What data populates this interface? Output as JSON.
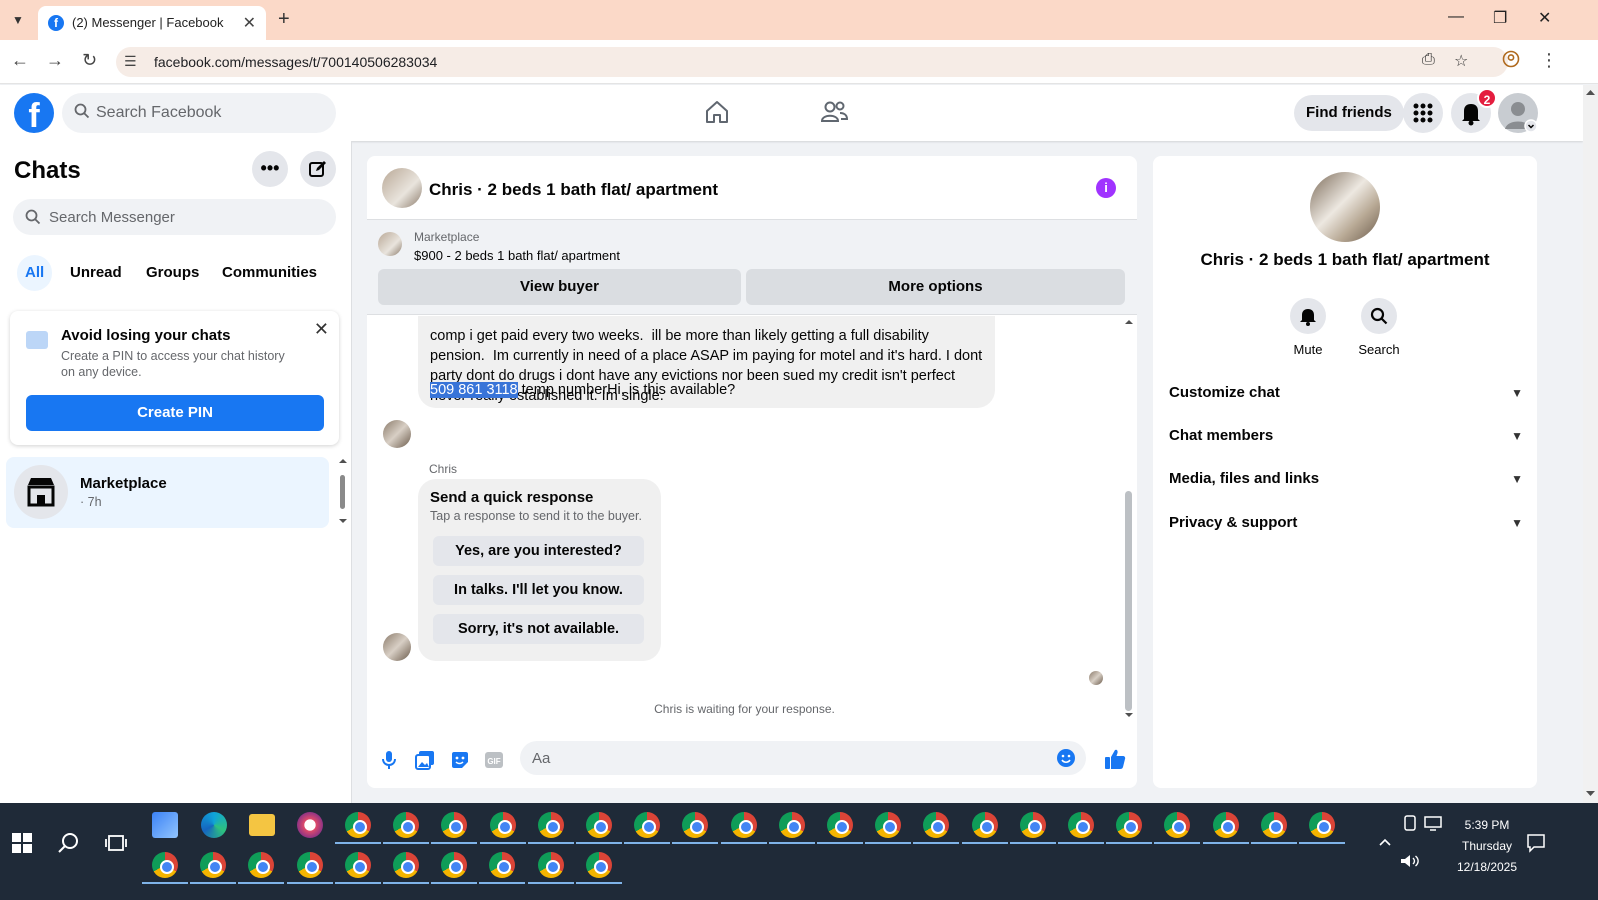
{
  "browser": {
    "tab_title": "(2) Messenger | Facebook",
    "url": "facebook.com/messages/t/700140506283034"
  },
  "header": {
    "search_placeholder": "Search Facebook",
    "find_friends": "Find friends",
    "notification_count": "2"
  },
  "sidebar": {
    "title": "Chats",
    "search_placeholder": "Search Messenger",
    "filters": [
      "All",
      "Unread",
      "Groups",
      "Communities"
    ],
    "pin_card": {
      "title": "Avoid losing your chats",
      "description": "Create a PIN to access your chat history on any device.",
      "button": "Create PIN"
    },
    "conversations": [
      {
        "name": "Marketplace",
        "time": "· 7h"
      }
    ]
  },
  "chat": {
    "title": "Chris · 2 beds 1 bath flat/ apartment",
    "marketplace": {
      "label": "Marketplace",
      "listing": "$900 - 2 beds 1 bath flat/ apartment",
      "view_buyer": "View buyer",
      "more_options": "More options"
    },
    "message_text": "comp i get paid every two weeks.  ill be more than likely getting a full disability pension.  Im currently in need of a place ASAP im paying for motel and it's hard. I dont party dont do drugs i dont have any evictions nor been sued my credit isn't perfect never really established it. Im single.",
    "phone_highlight": "509 861 3118",
    "message_tail": " temp numberHi, is this available?",
    "sender": "Chris",
    "quick_response": {
      "title": "Send a quick response",
      "subtitle": "Tap a response to send it to the buyer.",
      "options": [
        "Yes, are you interested?",
        "In talks. I'll let you know.",
        "Sorry, it's not available."
      ]
    },
    "waiting_text": "Chris is waiting for your response.",
    "composer_placeholder": "Aa"
  },
  "details": {
    "name": "Chris · 2 beds 1 bath flat/ apartment",
    "actions": [
      "Mute",
      "Search"
    ],
    "sections": [
      "Customize chat",
      "Chat members",
      "Media, files and links",
      "Privacy & support"
    ]
  },
  "taskbar": {
    "time": "5:39 PM",
    "day": "Thursday",
    "date": "12/18/2025"
  },
  "colors": {
    "brand": "#1877f2",
    "info_accent": "#a033ff",
    "badge": "#e41e3f",
    "selection": "#3874d8"
  }
}
